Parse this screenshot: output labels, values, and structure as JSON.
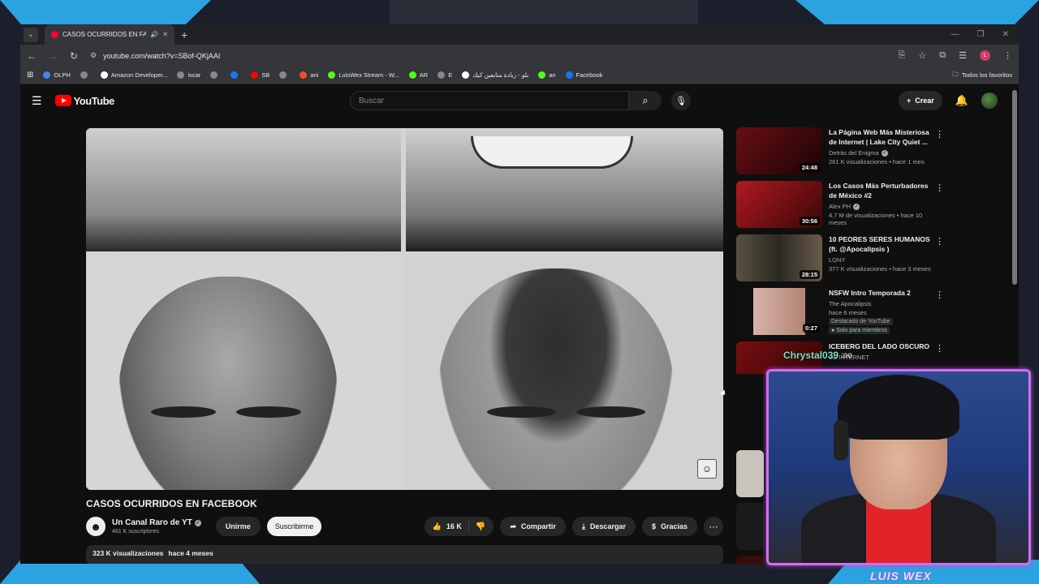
{
  "browser": {
    "tab": {
      "title": "CASOS OCURRIDOS EN FACEBOOK"
    },
    "url": "youtube.com/watch?v=SBof-QKjAAI",
    "bookmarks": [
      {
        "label": "OLPH"
      },
      {
        "label": ""
      },
      {
        "label": "Amazon Developer..."
      },
      {
        "label": "iscar"
      },
      {
        "label": ""
      },
      {
        "label": ""
      },
      {
        "label": "SB"
      },
      {
        "label": ""
      },
      {
        "label": "ani"
      },
      {
        "label": "LuisWex Stream - W..."
      },
      {
        "label": "AR"
      },
      {
        "label": "E"
      },
      {
        "label": "بلو - زيادة متابعين كيك"
      },
      {
        "label": "an"
      },
      {
        "label": "Facebook"
      }
    ],
    "all_bookmarks": "Todos los favoritos",
    "profile_initial": "L"
  },
  "youtube": {
    "logo": "YouTube",
    "search_placeholder": "Buscar",
    "create_label": "Crear",
    "video": {
      "title": "CASOS OCURRIDOS EN FACEBOOK",
      "channel": "Un Canal Raro de YT",
      "subscribers": "461 K suscriptores",
      "join": "Unirme",
      "subscribe": "Suscribirme",
      "likes": "16 K",
      "share": "Compartir",
      "download": "Descargar",
      "thanks": "Gracias",
      "views": "323 K visualizaciones",
      "age": "hace 4 meses"
    },
    "recommendations": [
      {
        "title": "La Página Web Más Misteriosa de Internet | Lake City Quiet ...",
        "channel": "Detrás del Enigma",
        "verified": true,
        "meta": "261 K visualizaciones • hace 1 mes",
        "duration": "24:48",
        "color": "#6a0f14"
      },
      {
        "title": "Los Casos Más Perturbadores de México #2",
        "channel": "Alex PH",
        "verified": true,
        "meta": "4,7 M de visualizaciones • hace 10 meses",
        "duration": "30:56",
        "color": "#8a1418"
      },
      {
        "title": "10 PEORES SERES HUMANOS (ft. @Apocalipsis )",
        "channel": "LONY",
        "verified": false,
        "meta": "377 K visualizaciones • hace 3 meses",
        "duration": "28:15",
        "color": "#3b3a2c"
      },
      {
        "title": "NSFW Intro Temporada 2",
        "channel": "The Apocalipsis",
        "verified": false,
        "meta": "hace 6 meses",
        "badge": "Destacado de YouTube",
        "members": "Solo para miembros",
        "duration": "0:27",
        "color": "#d6b3a8"
      },
      {
        "title": "ICEBERG DEL LADO OSCURO",
        "channel": "DE INTERNET",
        "verified": false,
        "meta": "",
        "duration": "",
        "color": "#7a0f12"
      }
    ]
  },
  "overlay": {
    "chat_user": "Chrystal039",
    "chat_text": ":oo",
    "streamer": "LUIS WEX"
  }
}
